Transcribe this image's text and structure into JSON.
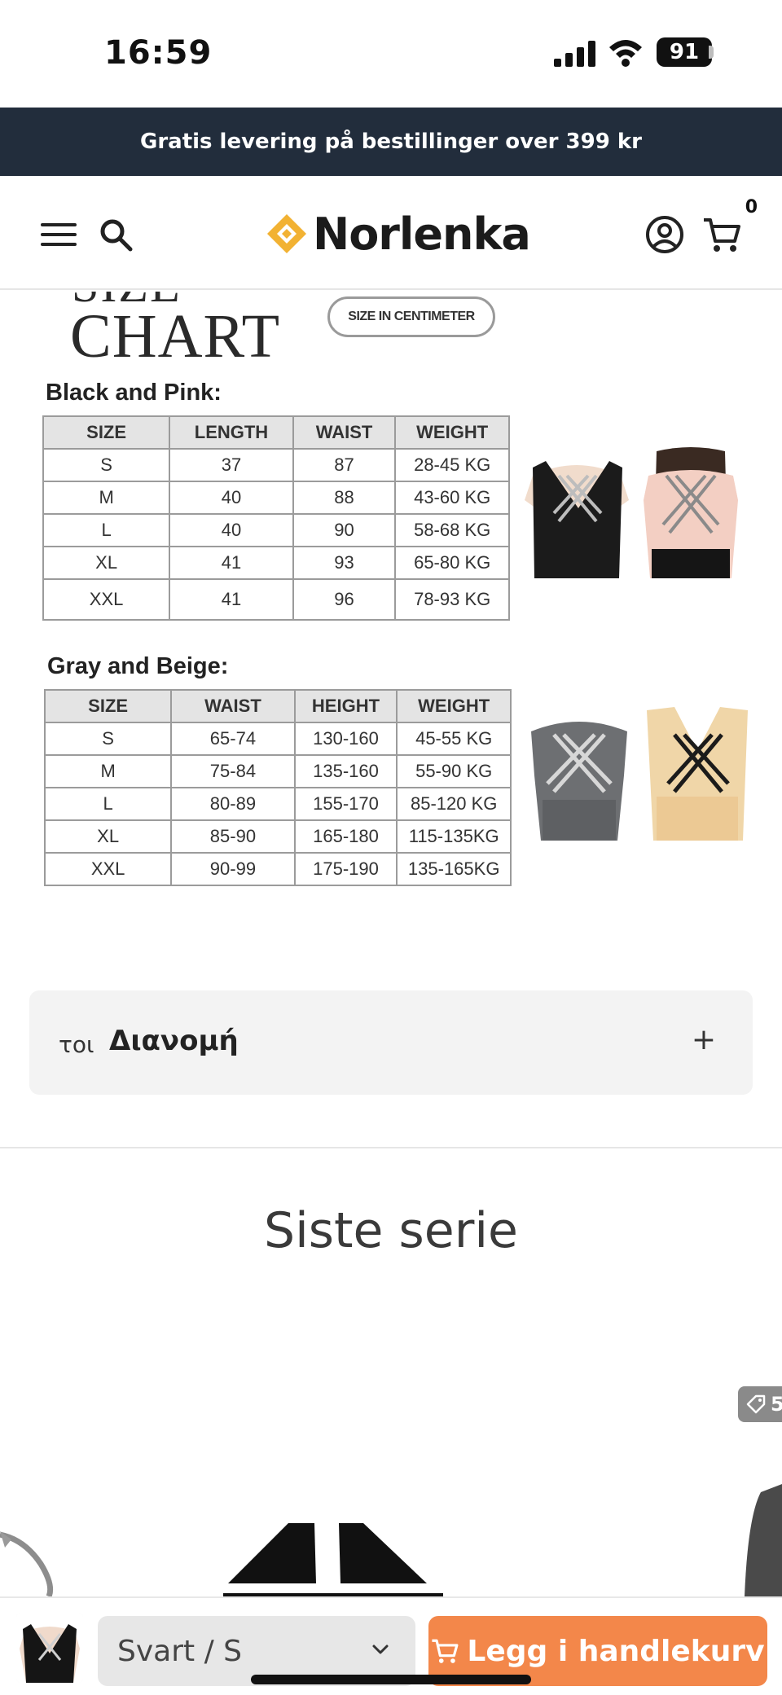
{
  "status_bar": {
    "time": "16:59",
    "battery": "91"
  },
  "announcement": {
    "text": "Gratis levering på bestillinger over 399 kr"
  },
  "header": {
    "brand": "Norlenka",
    "cart_count": "0"
  },
  "size_chart": {
    "partial_top_text": "SIZE",
    "title": "CHART",
    "unit_pill": "SIZE IN CENTIMETER",
    "groups": [
      {
        "title": "Black and Pink:",
        "headers": [
          "SIZE",
          "LENGTH",
          "WAIST",
          "WEIGHT"
        ],
        "rows": [
          [
            "S",
            "37",
            "87",
            "28-45 KG"
          ],
          [
            "M",
            "40",
            "88",
            "43-60 KG"
          ],
          [
            "L",
            "40",
            "90",
            "58-68 KG"
          ],
          [
            "XL",
            "41",
            "93",
            "65-80 KG"
          ],
          [
            "XXL",
            "41",
            "96",
            "78-93 KG"
          ]
        ]
      },
      {
        "title": "Gray and Beige:",
        "headers": [
          "SIZE",
          "WAIST",
          "HEIGHT",
          "WEIGHT"
        ],
        "rows": [
          [
            "S",
            "65-74",
            "130-160",
            "45-55 KG"
          ],
          [
            "M",
            "75-84",
            "135-160",
            "55-90 KG"
          ],
          [
            "L",
            "80-89",
            "155-170",
            "85-120 KG"
          ],
          [
            "XL",
            "85-90",
            "165-180",
            "115-135KG"
          ],
          [
            "XXL",
            "90-99",
            "175-190",
            "135-165KG"
          ]
        ]
      }
    ]
  },
  "accordion": {
    "prefix": "τοι",
    "title": "Διανομή",
    "toggle": "+"
  },
  "section": {
    "title": "Siste serie"
  },
  "carousel": {
    "badge": "5"
  },
  "buy_bar": {
    "variant": "Svart / S",
    "add_to_cart": "Legg i handlekurv"
  },
  "colors": {
    "announcement_bg": "#222d3c",
    "accent": "#f3874a",
    "logo_gold": "#f2b233"
  }
}
